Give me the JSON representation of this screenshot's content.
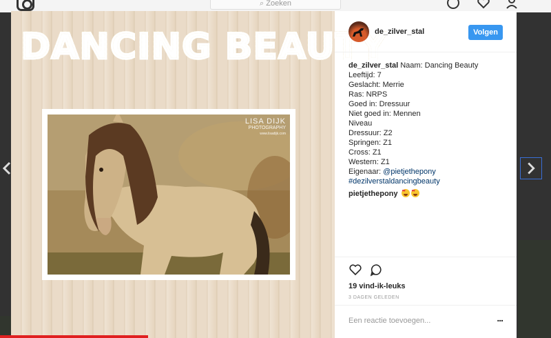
{
  "topbar": {
    "search_placeholder": "Zoeken"
  },
  "post": {
    "image_title": "DANCING BEAUTY",
    "watermark_line1": "LISA DIJK",
    "watermark_line2": "PHOTOGRAPHY",
    "watermark_line3": "www.lisadijk.com",
    "username": "de_zilver_stal",
    "follow_label": "Volgen",
    "caption_user": "de_zilver_stal",
    "caption_lines": [
      "Naam: Dancing Beauty",
      "Leeftijd: 7",
      "Geslacht: Merrie",
      "Ras: NRPS",
      "Goed in: Dressuur",
      "Niet goed in: Mennen",
      "Niveau",
      "Dressuur: Z2",
      "Springen: Z1",
      "Cross: Z1",
      "Western: Z1"
    ],
    "owner_label": "Eigenaar:",
    "owner_mention": "@pietjethepony",
    "hashtag": "#dezilverstaldancingbeauty",
    "comment_user": "pietjethepony",
    "likes": "19 vind-ik-leuks",
    "time": "3 DAGEN GELEDEN",
    "add_comment_placeholder": "Een reactie toevoegen...",
    "more_label": "..."
  },
  "colors": {
    "accent": "#3897f0",
    "link": "#003569"
  }
}
